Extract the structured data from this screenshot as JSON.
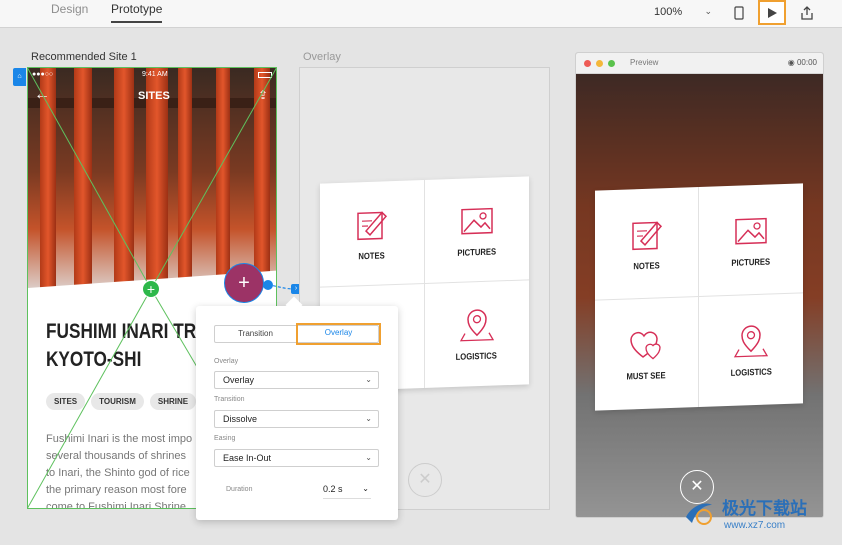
{
  "topbar": {
    "tabs": [
      "Design",
      "Prototype"
    ],
    "zoom": "100%"
  },
  "artboards": {
    "a1_label": "Recommended Site 1",
    "a2_label": "Overlay"
  },
  "screen1": {
    "time": "9:41 AM",
    "signal": "●●●○○",
    "nav_title": "SITES",
    "title_line1": "FUSHIMI INARI TRAI",
    "title_line2": "KYOTO-SHI",
    "tags": [
      "SITES",
      "TOURISM",
      "SHRINE"
    ],
    "body_lines": [
      "Fushimi Inari is the most impo",
      "several thousands of shrines",
      "to Inari, the Shinto god of rice",
      "the primary reason most fore",
      "come to Fushimi Inari Shrine"
    ]
  },
  "menu": {
    "notes": "NOTES",
    "pictures": "PICTURES",
    "must_see": "MUST SEE",
    "logistics": "LOGISTICS"
  },
  "popover": {
    "seg_transition": "Transition",
    "seg_overlay": "Overlay",
    "overlay_label": "Overlay",
    "overlay_value": "Overlay",
    "transition_label": "Transition",
    "transition_value": "Dissolve",
    "easing_label": "Easing",
    "easing_value": "Ease In-Out",
    "duration_label": "Duration",
    "duration_value": "0.2 s"
  },
  "preview": {
    "title": "Preview",
    "time": "00:00"
  },
  "watermark": {
    "text": "极光下载站",
    "url": "www.xz7.com"
  },
  "colors": {
    "accent": "#1a86e8",
    "highlight": "#f0a030",
    "icon": "#d62f57"
  }
}
